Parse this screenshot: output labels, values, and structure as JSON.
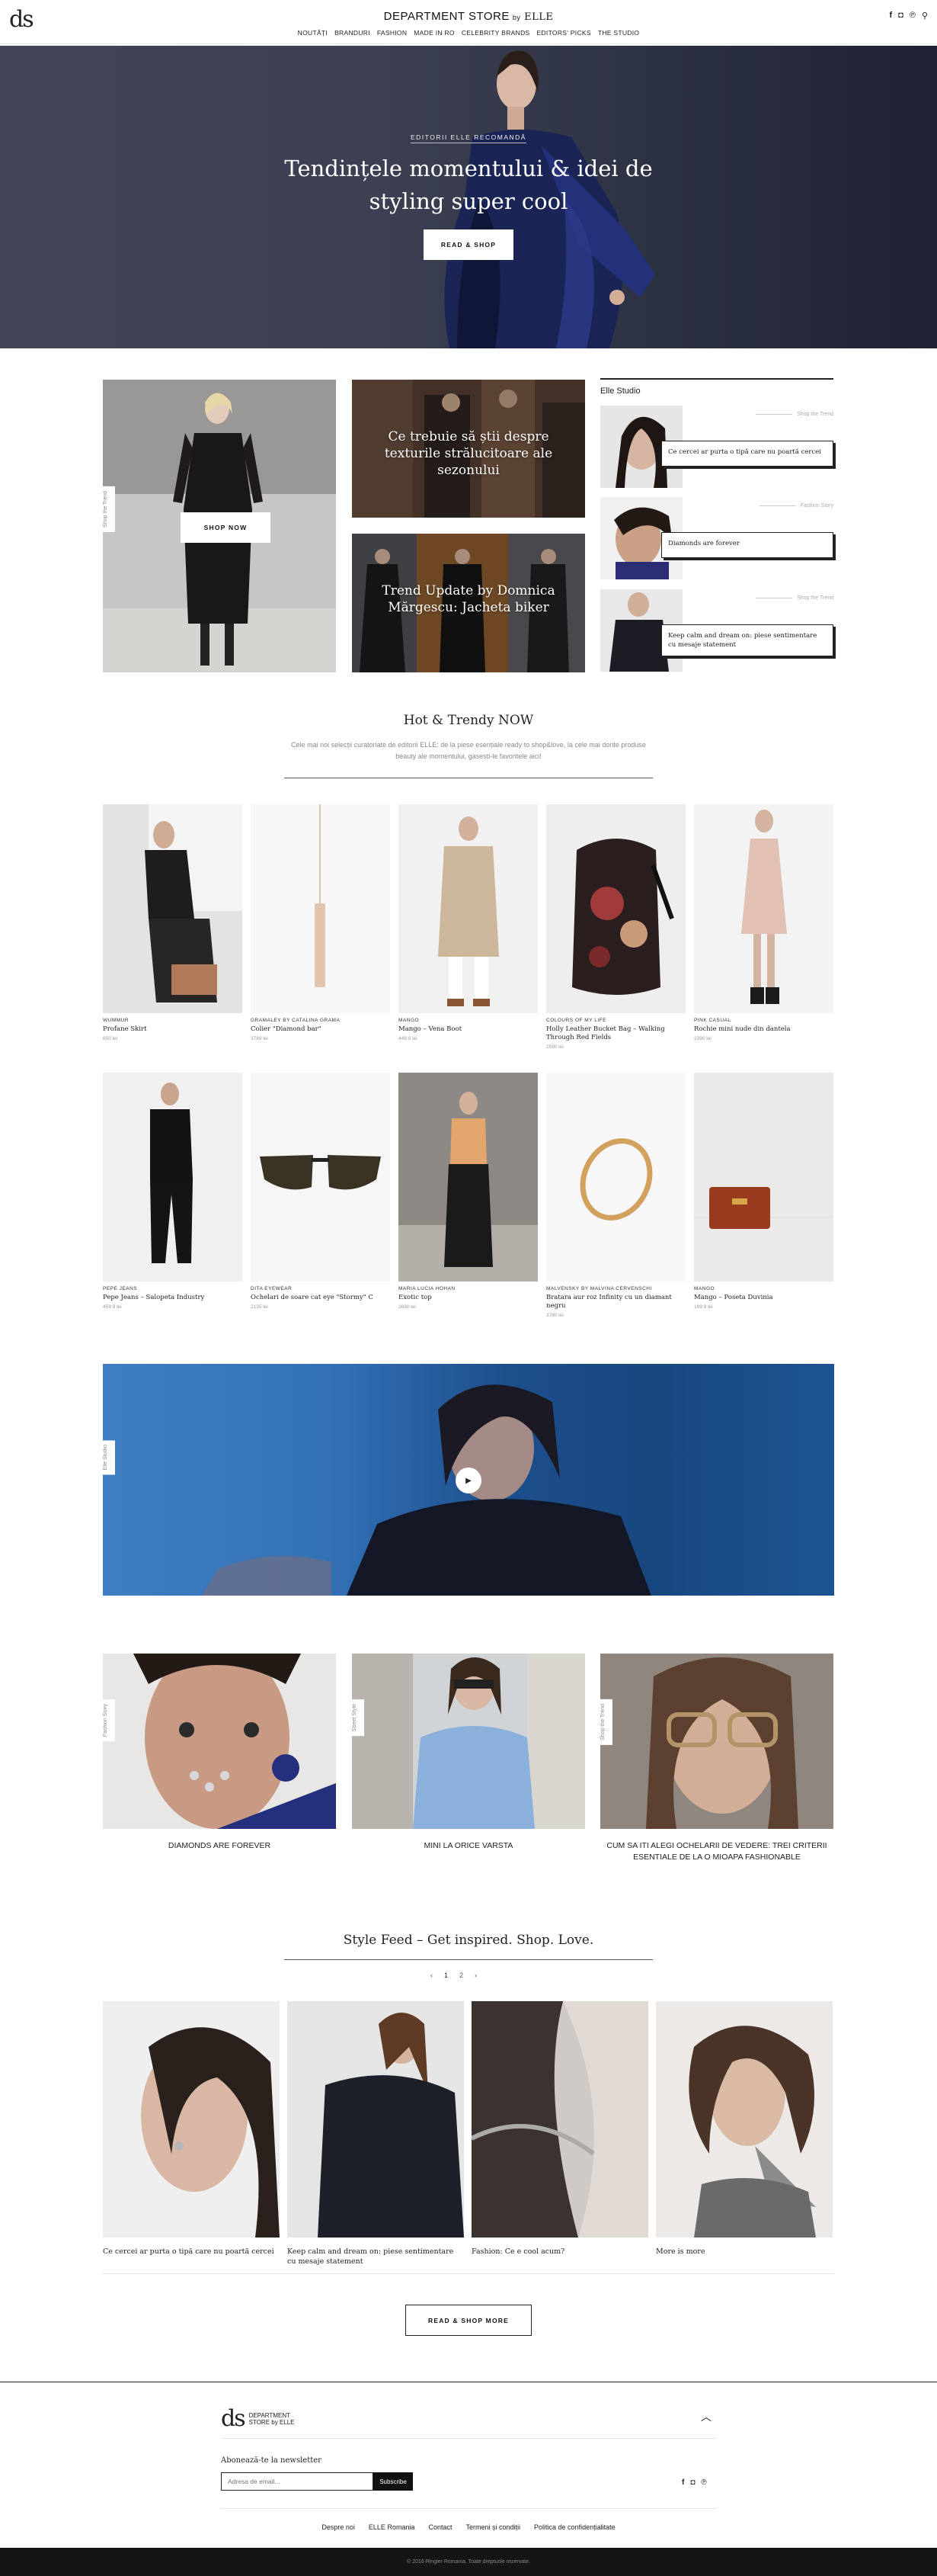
{
  "header": {
    "logo": "ds",
    "brand": "DEPARTMENT STORE",
    "brand_by": "by",
    "brand_elle": "ELLE",
    "nav": [
      "NOUTĂȚI",
      "BRANDURI",
      "FASHION",
      "MADE IN RO",
      "CELEBRITY BRANDS",
      "EDITORS' PICKS",
      "THE STUDIO"
    ]
  },
  "hero": {
    "kicker": "EDITORII ELLE RECOMANDĂ",
    "title": "Tendințele momentului & idei de styling super cool",
    "cta": "READ & SHOP"
  },
  "mosaic": {
    "left_tag": "Shop the Trend",
    "shop_now": "SHOP NOW",
    "top_caption": "Ce trebuie să știi despre texturile strălucitoare ale sezonului",
    "bottom_caption": "Trend Update by Domnica Mărgescu: Jacheta biker"
  },
  "studio": {
    "title": "Elle Studio",
    "items": [
      {
        "tag": "Shop the Trend",
        "text": "Ce cercei ar purta o tipă care nu poartă cercei"
      },
      {
        "tag": "Fashion Story",
        "text": "Diamonds are forever"
      },
      {
        "tag": "Shop the Trend",
        "text": "Keep calm and dream on: piese sentimentare cu mesaje statement"
      }
    ]
  },
  "hot": {
    "title": "Hot & Trendy NOW",
    "subtitle": "Cele mai noi selecții curatoriate de editorii ELLE: de la piese esențiale ready to shop&love, la cele mai dorite produse beauty ale momentului, gasesti-le favoritele aici!",
    "products": [
      {
        "brand": "WUMMUR",
        "name": "Profane Skirt",
        "price": "850 lei"
      },
      {
        "brand": "GRAMALEY BY CATALINA GRAMA",
        "name": "Colier \"Diamond bar\"",
        "price": "3789 lei"
      },
      {
        "brand": "MANGO",
        "name": "Mango – Vena Boot",
        "price": "449.9 lei"
      },
      {
        "brand": "COLOURS OF MY LIFE",
        "name": "Holly Leather Bucket Bag – Walking Through Red Fields",
        "price": "2590 lei"
      },
      {
        "brand": "PINK CASUAL",
        "name": "Rochie mini nude din dantela",
        "price": "2390 lei"
      },
      {
        "brand": "PEPE JEANS",
        "name": "Pepe Jeans – Salopeta Industry",
        "price": "459.9 lei"
      },
      {
        "brand": "DITA EYEWEAR",
        "name": "Ochelari de soare cat eye \"Stormy\" C",
        "price": "2135 lei"
      },
      {
        "brand": "MARIA LUCIA HOHAN",
        "name": "Exotic top",
        "price": "3690 lei"
      },
      {
        "brand": "MALVENSKY BY MALVINA CERVENSCHI",
        "name": "Bratara aur roz Infinity cu un diamant negru",
        "price": "3780 lei"
      },
      {
        "brand": "MANGO",
        "name": "Mango – Poseta Duvinia",
        "price": "199.9 lei"
      }
    ]
  },
  "video": {
    "tag": "Elle Studio"
  },
  "features": [
    {
      "tag": "Fashion Story",
      "caption": "DIAMONDS ARE FOREVER"
    },
    {
      "tag": "Street Style",
      "caption": "MINI LA ORICE VARSTA"
    },
    {
      "tag": "Shop the Trend",
      "caption": "CUM SA ITI ALEGI OCHELARII DE VEDERE: TREI CRITERII ESENTIALE DE LA O MIOAPA FASHIONABLE"
    }
  ],
  "feed": {
    "title": "Style Feed – Get inspired. Shop. Love.",
    "pager": {
      "prev": "‹",
      "current": "1",
      "next_page": "2",
      "next": "›"
    },
    "items": [
      {
        "text": "Ce cercei ar purta o tipă care nu poartă cercei"
      },
      {
        "text": "Keep calm and dream on: piese sentimentare cu mesaje statement"
      },
      {
        "text": "Fashion: Ce e cool acum?"
      },
      {
        "text": "More is more"
      }
    ],
    "more": "READ & SHOP MORE"
  },
  "footer": {
    "logo_ds": "ds",
    "logo_line1": "DEPARTMENT",
    "logo_line2": "STORE",
    "logo_line3": "by ELLE",
    "newsletter_title": "Abonează-te la newsletter",
    "newsletter_placeholder": "Adresa de email...",
    "subscribe": "Subscribe",
    "links": [
      "Despre noi",
      "ELLE Romania",
      "Contact",
      "Termeni și condiții",
      "Politica de confidențialitate"
    ],
    "copyright": "© 2016 Ringier Romania. Toate drepturile rezervate."
  }
}
